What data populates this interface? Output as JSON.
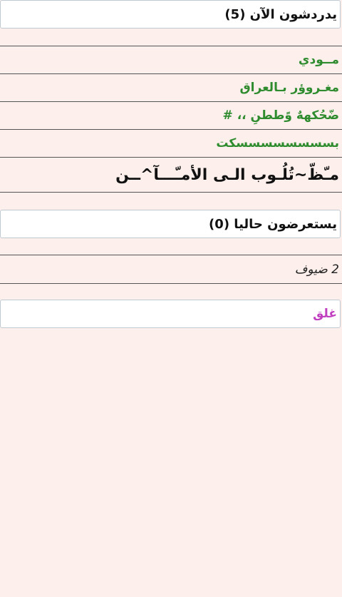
{
  "chatting": {
    "header": "يدردشون الآن (5)",
    "users": [
      "مــودي",
      "مغـروؤر بـالعراق",
      "ضّحُكههٌ وًططنِ ،، #",
      "بسسسسسسسسكت",
      "مـّظّ~تُلُـوب الـى الأمـّـــآ^ــن"
    ]
  },
  "viewing": {
    "header": "يستعرضون حاليا (0)"
  },
  "guests": {
    "label": "2 ضيوف"
  },
  "actions": {
    "close_label": "غلق"
  },
  "colors": {
    "background": "#fdf0ec",
    "username_green": "#2e8b2e",
    "close_magenta": "#c040c0"
  }
}
